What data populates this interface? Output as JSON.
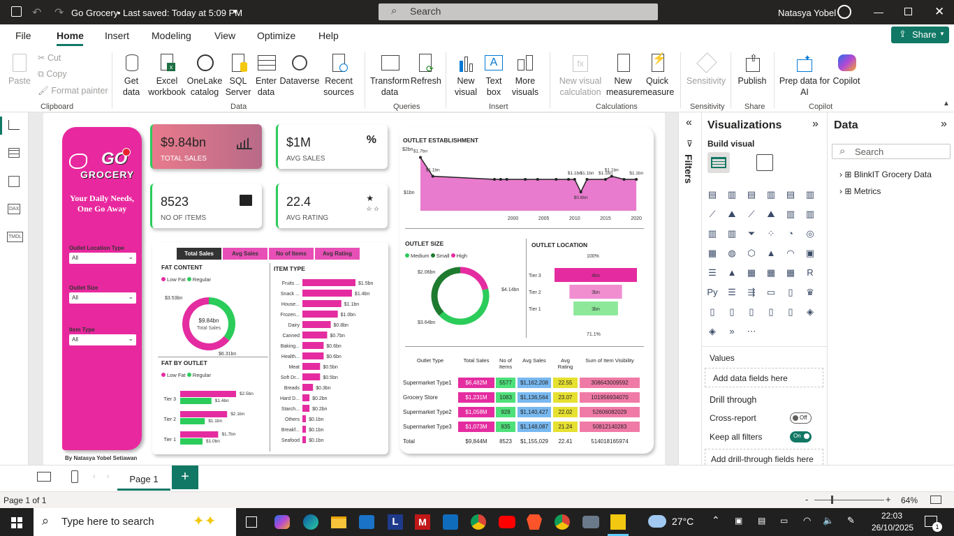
{
  "titlebar": {
    "app_title": "Go Grocery",
    "saved": "Last saved: Today at 5:09 PM",
    "search_placeholder": "Search",
    "user": "Natasya Yobel"
  },
  "menu": {
    "file": "File",
    "home": "Home",
    "insert": "Insert",
    "modeling": "Modeling",
    "view": "View",
    "optimize": "Optimize",
    "help": "Help",
    "share": "Share"
  },
  "ribbon": {
    "paste": "Paste",
    "cut": "Cut",
    "copy": "Copy",
    "format_painter": "Format painter",
    "clipboard": "Clipboard",
    "get_data": "Get data",
    "excel": "Excel workbook",
    "onelake": "OneLake catalog",
    "sql": "SQL Server",
    "enter_data": "Enter data",
    "dataverse": "Dataverse",
    "recent": "Recent sources",
    "data": "Data",
    "transform": "Transform data",
    "refresh": "Refresh",
    "queries": "Queries",
    "new_visual": "New visual",
    "text_box": "Text box",
    "more_visuals": "More visuals",
    "insert": "Insert",
    "new_visual_calc": "New visual calculation",
    "new_measure": "New measure",
    "quick_measure": "Quick measure",
    "calculations": "Calculations",
    "sensitivity": "Sensitivity",
    "sensitivity_grp": "Sensitivity",
    "publish": "Publish",
    "share_grp": "Share",
    "prep_data": "Prep data for AI",
    "copilot": "Copilot",
    "copilot_grp": "Copilot"
  },
  "report": {
    "logo_line1": "GO",
    "logo_line2": "GROCERY",
    "tagline": "Your Daily Needs, One Go Away",
    "slicers": [
      {
        "label": "Outlet Location Type",
        "value": "All"
      },
      {
        "label": "Outlet Size",
        "value": "All"
      },
      {
        "label": "Item Type",
        "value": "All"
      }
    ],
    "author": "By Natasya Yobel Setiawan",
    "kpis": [
      {
        "value": "$9.84bn",
        "label": "TOTAL SALES"
      },
      {
        "value": "$1M",
        "label": "AVG SALES"
      },
      {
        "value": "8523",
        "label": "NO OF ITEMS"
      },
      {
        "value": "22.4",
        "label": "AVG RATING"
      }
    ],
    "tabs": [
      "Total Sales",
      "Avg Sales",
      "No of Items",
      "Avg Rating"
    ],
    "fat_content": {
      "title": "FAT CONTENT",
      "legend": [
        "Low Fat",
        "Regular"
      ],
      "center_value": "$9.84bn",
      "center_label": "Total Sales",
      "label_regular": "$3.53bn",
      "label_lowfat": "$6.31bn"
    },
    "fat_by_outlet": {
      "title": "FAT BY OUTLET",
      "legend": [
        "Low Fat",
        "Regular"
      ]
    },
    "item_type": {
      "title": "ITEM TYPE"
    },
    "outlet_est": {
      "title": "OUTLET ESTABLISHMENT",
      "y_top": "$2bn",
      "y_mid": "$1bn"
    },
    "outlet_size": {
      "title": "OUTLET SIZE",
      "legend": [
        "Medium",
        "Small",
        "High"
      ],
      "label_medium": "$4.14bn",
      "label_small": "$3.64bn",
      "label_high": "$2.06bn"
    },
    "outlet_location": {
      "title": "OUTLET LOCATION",
      "top_pct": "100%",
      "bottom_pct": "71.1%"
    },
    "table": {
      "headers": [
        "Outlet Type",
        "Total Sales",
        "No of Items",
        "Avg Sales",
        "Avg Rating",
        "Sum of Item Visibility"
      ],
      "rows": [
        [
          "Supermarket Type1",
          "$6,482M",
          "5577",
          "$1,162,208",
          "22.55",
          "308643009592"
        ],
        [
          "Grocery Store",
          "$1,231M",
          "1083",
          "$1,136,564",
          "23.07",
          "101956934070"
        ],
        [
          "Supermarket Type2",
          "$1,058M",
          "928",
          "$1,140,427",
          "22.02",
          "52606082029"
        ],
        [
          "Supermarket Type3",
          "$1,073M",
          "935",
          "$1,148,087",
          "21.24",
          "50812140283"
        ]
      ],
      "total": [
        "Total",
        "$9,844M",
        "8523",
        "$1,155,029",
        "22.41",
        "514018165974"
      ]
    }
  },
  "chart_data": [
    {
      "type": "bar",
      "title": "ITEM TYPE",
      "categories": [
        "Fruits ...",
        "Snack ...",
        "House...",
        "Frozen...",
        "Dairy",
        "Canned",
        "Baking...",
        "Health...",
        "Meat",
        "Soft Dr...",
        "Breads",
        "Hard D...",
        "Starch...",
        "Others",
        "Breakf...",
        "Seafood"
      ],
      "values": [
        1.5,
        1.4,
        1.1,
        1.0,
        0.8,
        0.7,
        0.6,
        0.6,
        0.5,
        0.5,
        0.3,
        0.2,
        0.2,
        0.1,
        0.1,
        0.1
      ],
      "labels": [
        "$1.5bn",
        "$1.4bn",
        "$1.1bn",
        "$1.0bn",
        "$0.8bn",
        "$0.7bn",
        "$0.6bn",
        "$0.6bn",
        "$0.5bn",
        "$0.5bn",
        "$0.3bn",
        "$0.2bn",
        "$0.2bn",
        "$0.1bn",
        "$0.1bn",
        "$0.1bn"
      ],
      "color": "#e42ca0"
    },
    {
      "type": "bar",
      "title": "FAT BY OUTLET",
      "categories": [
        "Tier 3",
        "Tier 2",
        "Tier 1"
      ],
      "series": [
        {
          "name": "Low Fat",
          "values": [
            2.5,
            2.1,
            1.7
          ],
          "labels": [
            "$2.5bn",
            "$2.1bn",
            "$1.7bn"
          ],
          "color": "#e42ca0"
        },
        {
          "name": "Regular",
          "values": [
            1.4,
            1.1,
            1.0
          ],
          "labels": [
            "$1.4bn",
            "$1.1bn",
            "$1.0bn"
          ],
          "color": "#2bcc5a"
        }
      ]
    },
    {
      "type": "area",
      "title": "OUTLET ESTABLISHMENT",
      "x": [
        1985,
        1987,
        1997,
        1998,
        1999,
        2002,
        2004,
        2007,
        2009,
        2010,
        2011,
        2012,
        2015,
        2016,
        2018,
        2020
      ],
      "y": [
        1.7,
        1.1,
        1.0,
        1.0,
        1.0,
        1.0,
        1.0,
        1.0,
        1.0,
        1.0,
        0.6,
        1.0,
        1.0,
        1.1,
        1.0,
        1.0
      ],
      "point_labels": [
        {
          "x": 1985,
          "text": "$1.7bn"
        },
        {
          "x": 1987,
          "text": "$1.1bn"
        },
        {
          "x": 2010,
          "text": "$1.1bn"
        },
        {
          "x": 2011,
          "text": "$0.6bn"
        },
        {
          "x": 2012,
          "text": "$1.1bn"
        },
        {
          "x": 2015,
          "text": "$1.1bn"
        },
        {
          "x": 2016,
          "text": "$1.1bn"
        },
        {
          "x": 2020,
          "text": "$1.1bn"
        }
      ],
      "x_ticks": [
        "2000",
        "2005",
        "2010",
        "2015",
        "2020"
      ],
      "color": "#e42ca0"
    },
    {
      "type": "pie",
      "title": "FAT CONTENT",
      "slices": [
        {
          "name": "Low Fat",
          "value": 6.31,
          "label": "$6.31bn",
          "color": "#e42ca0"
        },
        {
          "name": "Regular",
          "value": 3.53,
          "label": "$3.53bn",
          "color": "#2bcc5a"
        }
      ]
    },
    {
      "type": "pie",
      "title": "OUTLET SIZE",
      "slices": [
        {
          "name": "Medium",
          "value": 4.14,
          "label": "$4.14bn",
          "color": "#2bcc5a"
        },
        {
          "name": "Small",
          "value": 3.64,
          "label": "$3.64bn",
          "color": "#1e7a2e"
        },
        {
          "name": "High",
          "value": 2.06,
          "label": "$2.06bn",
          "color": "#e42ca0"
        }
      ]
    },
    {
      "type": "bar",
      "title": "OUTLET LOCATION",
      "categories": [
        "Tier 3",
        "Tier 2",
        "Tier 1"
      ],
      "values": [
        4,
        3,
        3
      ],
      "labels": [
        "4bn",
        "3bn",
        "3bn"
      ],
      "colors": [
        "#e42ca0",
        "#f08ed0",
        "#8ee89a"
      ]
    }
  ],
  "panes": {
    "filters": "Filters",
    "visualizations": "Visualizations",
    "build_visual": "Build visual",
    "data": "Data",
    "search_placeholder": "Search",
    "tree": [
      "BlinkIT Grocery Data",
      "Metrics"
    ],
    "values": "Values",
    "add_data": "Add data fields here",
    "drill": "Drill through",
    "cross_report": "Cross-report",
    "cross_state": "Off",
    "keep_filters": "Keep all filters",
    "keep_state": "On",
    "add_drill": "Add drill-through fields here"
  },
  "pages": {
    "tab": "Page 1",
    "status": "Page 1 of 1",
    "zoom": "64%"
  },
  "taskbar": {
    "search": "Type here to search",
    "weather": "27°C",
    "time": "22:03",
    "date": "26/10/2025",
    "notif": "1"
  },
  "colors": {
    "pink": "#e42ca0",
    "green": "#2bcc5a",
    "dark_green": "#1e7a2e",
    "brand": "#117865"
  }
}
